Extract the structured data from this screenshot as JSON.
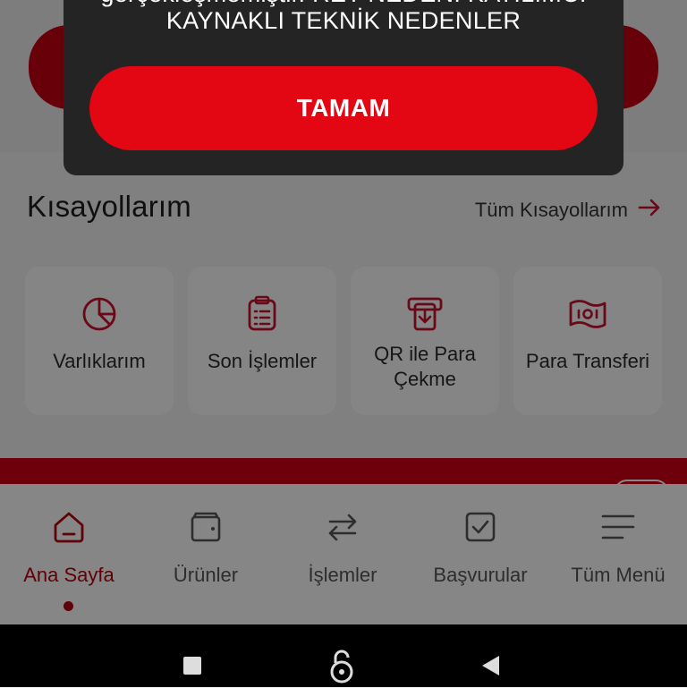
{
  "dialog": {
    "message_line1": "gerçekleşmemiştir. RET NEDENİ KATILIMCI",
    "message_line2": "KAYNAKLI TEKNİK NEDENLER",
    "ok_label": "TAMAM"
  },
  "shortcuts": {
    "title": "Kısayollarım",
    "all_label": "Tüm Kısayollarım",
    "items": [
      {
        "label": "Varlıklarım",
        "icon": "pie-chart-icon"
      },
      {
        "label": "Son İşlemler",
        "icon": "clipboard-list-icon"
      },
      {
        "label_line1": "QR ile Para",
        "label_line2": "Çekme",
        "icon": "atm-withdraw-icon"
      },
      {
        "label": "Para Transferi",
        "icon": "money-transfer-icon"
      }
    ]
  },
  "nav": {
    "items": [
      {
        "label": "Ana Sayfa",
        "icon": "home-icon",
        "active": true
      },
      {
        "label": "Ürünler",
        "icon": "wallet-icon"
      },
      {
        "label": "İşlemler",
        "icon": "swap-arrows-icon"
      },
      {
        "label": "Başvurular",
        "icon": "checkbox-icon"
      },
      {
        "label": "Tüm Menü",
        "icon": "menu-icon"
      }
    ]
  },
  "colors": {
    "brand_red": "#e30613",
    "active_red": "#b5000f",
    "dialog_bg": "#242424"
  }
}
